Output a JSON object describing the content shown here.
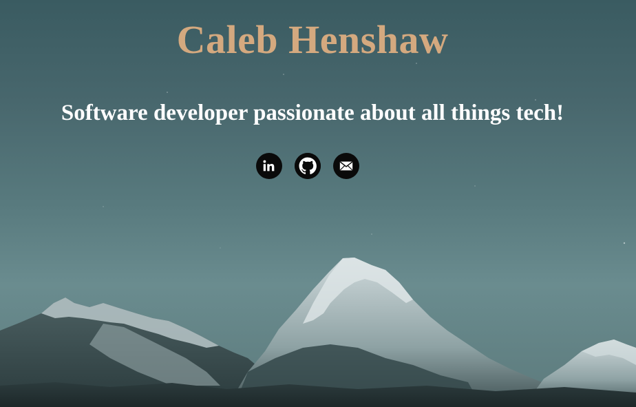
{
  "header": {
    "name": "Caleb Henshaw",
    "tagline": "Software developer passionate about all things tech!"
  },
  "socials": [
    {
      "icon": "linkedin-icon",
      "label": "LinkedIn"
    },
    {
      "icon": "github-icon",
      "label": "GitHub"
    },
    {
      "icon": "email-icon",
      "label": "Email"
    }
  ],
  "colors": {
    "name": "#d4a97f",
    "tagline": "#ffffff",
    "icon_bg": "#0a0a0a",
    "sky_top": "#3a5b61",
    "sky_bottom": "#6a8c8f"
  }
}
